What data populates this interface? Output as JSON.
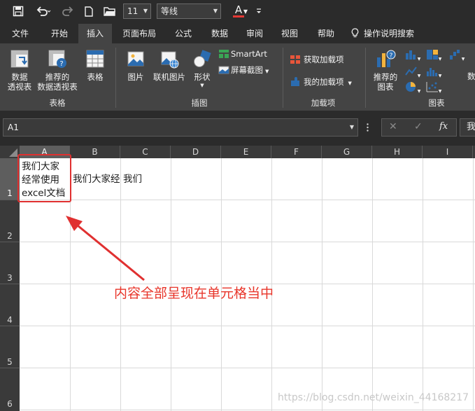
{
  "qat": {
    "font_size": "11",
    "font_name": "等线",
    "font_color_letter": "A",
    "font_color_accent": "#e53935"
  },
  "tabs": [
    {
      "label": "文件"
    },
    {
      "label": "开始"
    },
    {
      "label": "插入",
      "active": true
    },
    {
      "label": "页面布局"
    },
    {
      "label": "公式"
    },
    {
      "label": "数据"
    },
    {
      "label": "审阅"
    },
    {
      "label": "视图"
    },
    {
      "label": "帮助"
    },
    {
      "label": "操作说明搜索"
    }
  ],
  "ribbon": {
    "tables_group": {
      "pivot_line1": "数据",
      "pivot_line2": "透视表",
      "rec_pivot_line1": "推荐的",
      "rec_pivot_line2": "数据透视表",
      "table": "表格",
      "group_label": "表格"
    },
    "illustrations_group": {
      "pictures": "图片",
      "online_pictures": "联机图片",
      "shapes": "形状",
      "smartart": "SmartArt",
      "screenshot": "屏幕截图",
      "group_label": "插图"
    },
    "addins_group": {
      "get_addins": "获取加载项",
      "my_addins": "我的加载项",
      "group_label": "加载项"
    },
    "charts_group": {
      "rec_charts_line1": "推荐的",
      "rec_charts_line2": "图表",
      "cut_label": "数",
      "group_label": "图表"
    }
  },
  "formula_bar": {
    "name_box": "A1",
    "cancel": "✕",
    "enter": "✓",
    "fx": "fx",
    "content_visible": "我"
  },
  "sheet": {
    "columns": [
      "A",
      "B",
      "C",
      "D",
      "E",
      "F",
      "G",
      "H",
      "I"
    ],
    "rows": [
      "1",
      "2",
      "3",
      "4",
      "5",
      "6"
    ],
    "selected_cell": "A1",
    "a1_lines": [
      "我们大家",
      "经常使用",
      "excel文档"
    ],
    "b1_text": "我们大家经",
    "c1_text": "我们"
  },
  "annotation": {
    "text": "内容全部呈现在单元格当中",
    "color": "#e8352a"
  },
  "watermark": "https://blog.csdn.net/weixin_44168217"
}
